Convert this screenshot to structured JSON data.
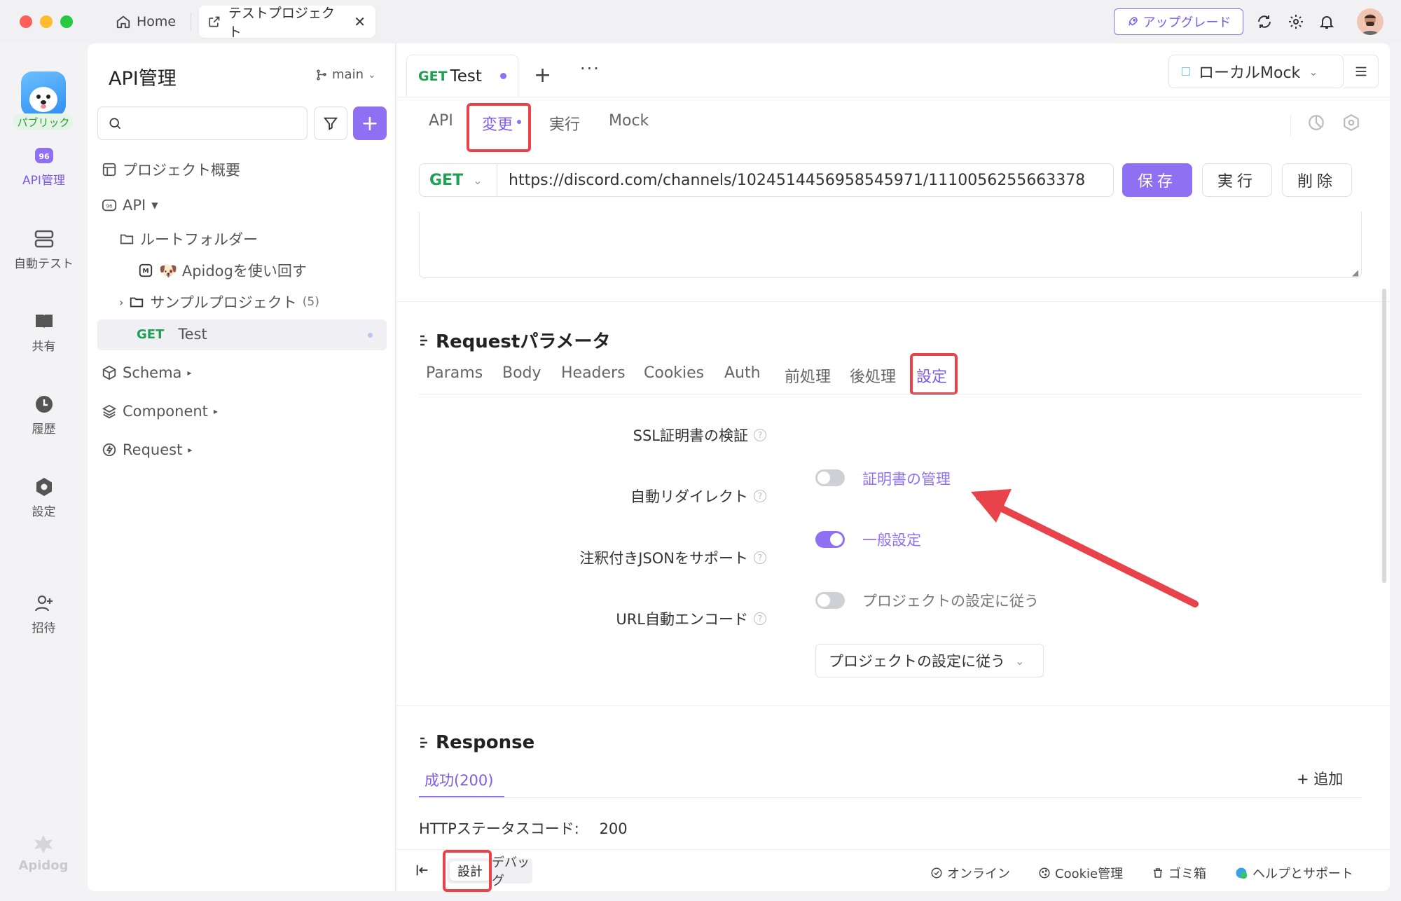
{
  "titlebar": {
    "home_label": "Home",
    "project_tab": "テストプロジェクト",
    "upgrade_label": "アップグレード"
  },
  "rail": {
    "public_badge": "パブリック",
    "items": [
      {
        "label": "API管理"
      },
      {
        "label": "自動テスト"
      },
      {
        "label": "共有"
      },
      {
        "label": "履歴"
      },
      {
        "label": "設定"
      },
      {
        "label": "招待"
      }
    ],
    "logo_text": "Apidog"
  },
  "sidebar": {
    "title": "API管理",
    "branch": "main",
    "search_placeholder": "",
    "tree": {
      "overview": "プロジェクト概要",
      "api": "API",
      "root_folder": "ルートフォルダー",
      "doc": "🐶 Apidogを使い回す",
      "sample_project": "サンプルプロジェクト",
      "sample_count": "(5)",
      "test_method": "GET",
      "test_name": "Test",
      "schema": "Schema",
      "component": "Component",
      "request": "Request"
    }
  },
  "main": {
    "doc_tab": {
      "method": "GET",
      "name": "Test"
    },
    "env": "ローカルMock",
    "sub_tabs": [
      {
        "label": "API"
      },
      {
        "label": "変更"
      },
      {
        "label": "実行"
      },
      {
        "label": "Mock"
      }
    ],
    "method": "GET",
    "url": "https://discord.com/channels/1024514456958545971/1110056255663378",
    "save_label": "保存",
    "run_label": "実行",
    "delete_label": "削除",
    "request_section_title": "Requestパラメータ",
    "param_tabs": [
      {
        "label": "Params"
      },
      {
        "label": "Body"
      },
      {
        "label": "Headers"
      },
      {
        "label": "Cookies"
      },
      {
        "label": "Auth"
      },
      {
        "label": "前処理"
      },
      {
        "label": "後処理"
      },
      {
        "label": "設定"
      }
    ],
    "settings": {
      "ssl_label": "SSL証明書の検証",
      "ssl_on": false,
      "ssl_link": "証明書の管理",
      "redirect_label": "自動リダイレクト",
      "redirect_on": true,
      "redirect_link": "一般設定",
      "json_label": "注釈付きJSONをサポート",
      "json_on": false,
      "json_text": "プロジェクトの設定に従う",
      "encode_label": "URL自動エンコード",
      "encode_value": "プロジェクトの設定に従う"
    },
    "response_section_title": "Response",
    "response_tab": "成功(200)",
    "add_label": "+ 追加",
    "status_code_label": "HTTPステータスコード:",
    "status_code_value": "200"
  },
  "bottom_bar": {
    "design": "設計",
    "debug": "デバッグ",
    "online": "オンライン",
    "cookie": "Cookie管理",
    "trash": "ゴミ箱",
    "help": "ヘルプとサポート"
  },
  "colors": {
    "accent": "#8f6ff2",
    "get_green": "#1fa055",
    "highlight_red": "#e8434a"
  }
}
